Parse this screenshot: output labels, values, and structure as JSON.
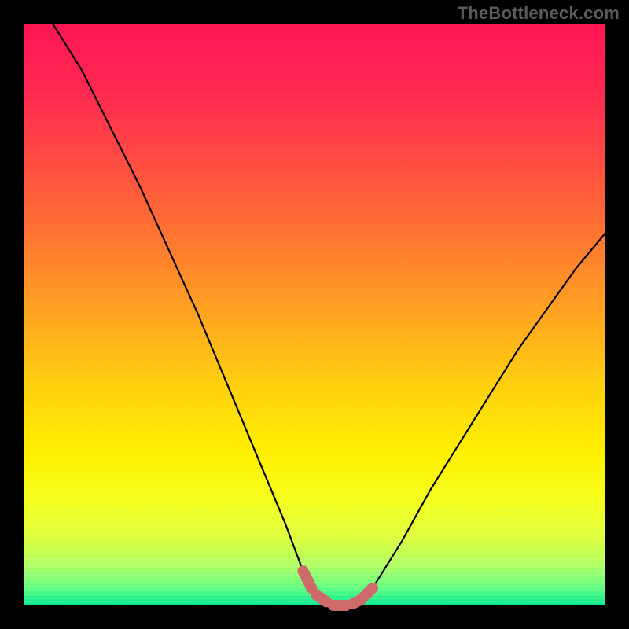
{
  "watermark": "TheBottleneck.com",
  "colors": {
    "background": "#000000",
    "curve": "#000000",
    "marker": "#cf6a6a",
    "gradient_stops": [
      {
        "offset": 0.0,
        "color": "#ff1555"
      },
      {
        "offset": 0.12,
        "color": "#ff2a50"
      },
      {
        "offset": 0.25,
        "color": "#ff5040"
      },
      {
        "offset": 0.38,
        "color": "#ff7a30"
      },
      {
        "offset": 0.5,
        "color": "#ffa520"
      },
      {
        "offset": 0.62,
        "color": "#ffd010"
      },
      {
        "offset": 0.74,
        "color": "#fff000"
      },
      {
        "offset": 0.82,
        "color": "#f5ff20"
      },
      {
        "offset": 0.88,
        "color": "#e0ff40"
      },
      {
        "offset": 0.93,
        "color": "#b0ff60"
      },
      {
        "offset": 0.97,
        "color": "#60ff80"
      },
      {
        "offset": 1.0,
        "color": "#00e890"
      }
    ]
  },
  "chart_data": {
    "type": "line",
    "title": "",
    "xlabel": "",
    "ylabel": "",
    "xlim": [
      0,
      100
    ],
    "ylim": [
      0,
      100
    ],
    "curve": [
      {
        "x": 5,
        "y": 100
      },
      {
        "x": 10,
        "y": 92
      },
      {
        "x": 15,
        "y": 82
      },
      {
        "x": 20,
        "y": 72
      },
      {
        "x": 25,
        "y": 61
      },
      {
        "x": 30,
        "y": 50
      },
      {
        "x": 35,
        "y": 38
      },
      {
        "x": 40,
        "y": 26
      },
      {
        "x": 45,
        "y": 14
      },
      {
        "x": 48,
        "y": 6
      },
      {
        "x": 50,
        "y": 2
      },
      {
        "x": 53,
        "y": 0
      },
      {
        "x": 56,
        "y": 0
      },
      {
        "x": 58,
        "y": 1
      },
      {
        "x": 60,
        "y": 3
      },
      {
        "x": 65,
        "y": 11
      },
      {
        "x": 70,
        "y": 20
      },
      {
        "x": 75,
        "y": 28
      },
      {
        "x": 80,
        "y": 36
      },
      {
        "x": 85,
        "y": 44
      },
      {
        "x": 90,
        "y": 51
      },
      {
        "x": 95,
        "y": 58
      },
      {
        "x": 100,
        "y": 64
      }
    ],
    "highlight_range_x": [
      49,
      59
    ],
    "minimum_x": 55,
    "minimum_y": 0
  }
}
